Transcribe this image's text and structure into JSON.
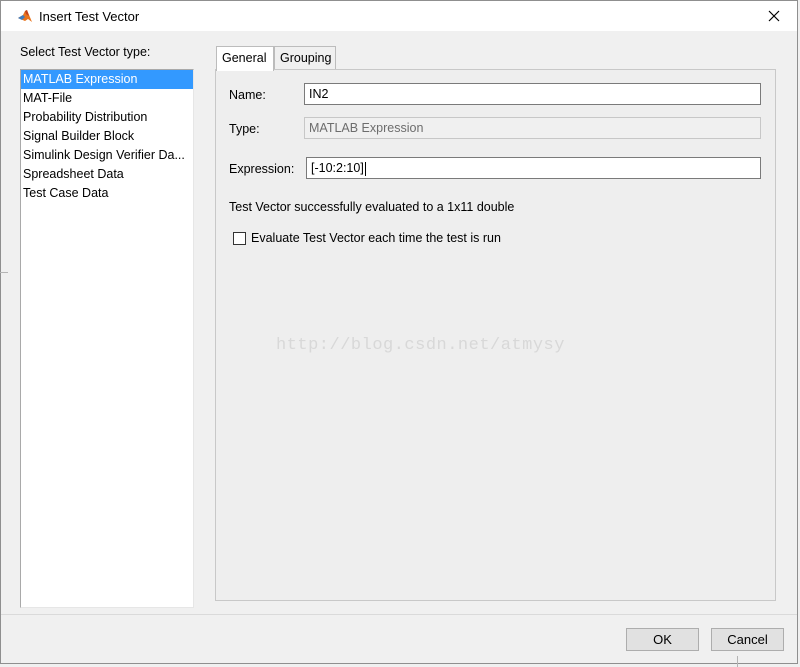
{
  "window": {
    "title": "Insert Test Vector"
  },
  "left": {
    "label": "Select Test Vector type:",
    "items": [
      "MATLAB Expression",
      "MAT-File",
      "Probability Distribution",
      "Signal Builder Block",
      "Simulink Design Verifier Da...",
      "Spreadsheet Data",
      "Test Case Data"
    ],
    "selected_index": 0
  },
  "tabs": [
    {
      "label": "General",
      "active": true
    },
    {
      "label": "Grouping",
      "active": false
    }
  ],
  "form": {
    "name_label": "Name:",
    "name_value": "IN2",
    "type_label": "Type:",
    "type_value": "MATLAB Expression",
    "expression_label": "Expression:",
    "expression_value": "[-10:2:10]",
    "status": "Test Vector successfully evaluated to a 1x11 double",
    "checkbox_label": "Evaluate Test Vector each time the test is run",
    "checkbox_checked": false
  },
  "watermark": "http://blog.csdn.net/atmysy",
  "buttons": {
    "ok": "OK",
    "cancel": "Cancel"
  },
  "colors": {
    "selection": "#3399ff",
    "window_bg": "#f0f0f0"
  }
}
